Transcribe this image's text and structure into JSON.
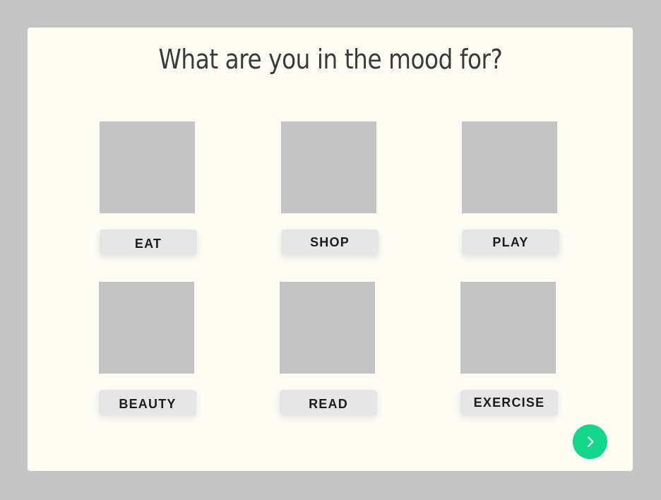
{
  "prompt": {
    "title": "What are you in the mood for?"
  },
  "options": [
    {
      "label": "EAT"
    },
    {
      "label": "SHOP"
    },
    {
      "label": "PLAY"
    },
    {
      "label": "BEAUTY"
    },
    {
      "label": "READ"
    },
    {
      "label": "EXERCISE"
    }
  ],
  "next_button": {
    "icon": "chevron-right-icon"
  },
  "colors": {
    "background": "#c4c4c4",
    "card": "#fdfdf4",
    "placeholder": "#c4c4c4",
    "button": "#e6e6e6",
    "accent": "#13d68b",
    "text": "#1c1c1c"
  }
}
